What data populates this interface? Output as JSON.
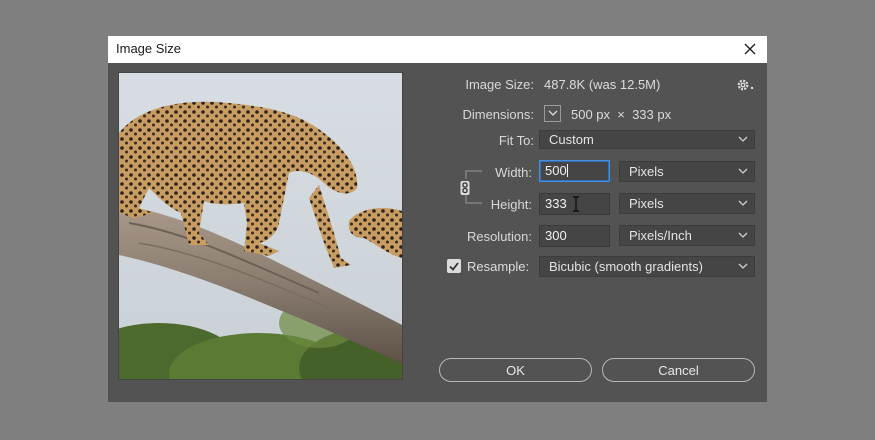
{
  "dialog": {
    "title": "Image Size",
    "image_size_label": "Image Size:",
    "image_size_value": "487.8K (was 12.5M)",
    "dimensions_label": "Dimensions:",
    "dimensions_value": "500 px  ×  333 px",
    "fit_to_label": "Fit To:",
    "fit_to_value": "Custom",
    "width_label": "Width:",
    "width_value": "500",
    "width_unit": "Pixels",
    "height_label": "Height:",
    "height_value": "333",
    "height_unit": "Pixels",
    "resolution_label": "Resolution:",
    "resolution_value": "300",
    "resolution_unit": "Pixels/Inch",
    "resample_label": "Resample:",
    "resample_checked": true,
    "resample_value": "Bicubic (smooth gradients)",
    "ok_label": "OK",
    "cancel_label": "Cancel"
  },
  "icons": {
    "close": "close-icon",
    "settings": "gear-icon",
    "dimensions_toggle": "chevron-down-icon",
    "constrain": "chain-link-icon",
    "checkbox": "checkmark-icon",
    "text_cursor": "i-beam-cursor-icon"
  },
  "colors": {
    "dialog_bg": "#535353",
    "desktop_bg": "#7f7f7f",
    "focus_border": "#4a8fd9"
  }
}
